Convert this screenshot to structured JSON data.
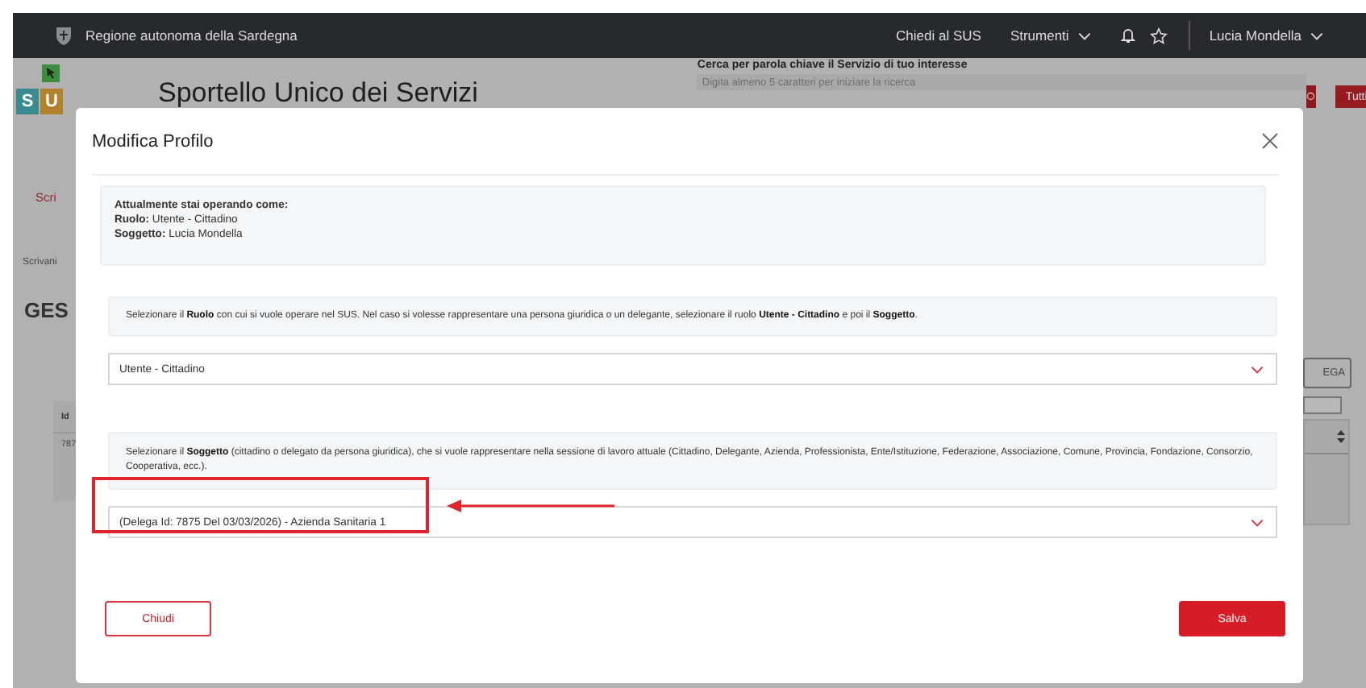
{
  "top_bar": {
    "region": "Regione autonoma della Sardegna",
    "links": [
      {
        "label": "Chiedi al SUS",
        "dropdown": false
      },
      {
        "label": "Strumenti",
        "dropdown": true
      }
    ],
    "user": "Lucia Mondella"
  },
  "header": {
    "logo_letters": [
      "S",
      "U"
    ],
    "title": "Sportello Unico dei Servizi",
    "search": {
      "label": "Cerca per parola chiave il Servizio di tuo interesse",
      "placeholder": "Digita almeno 5 caratteri per iniziare la ricerca"
    },
    "filter_button": "Tutti"
  },
  "background_left": {
    "link": "Scri",
    "breadcrumb": "Scrivani",
    "heading": "GES",
    "table": {
      "column_1": "Id",
      "cell": "787"
    }
  },
  "background_right": {
    "button": "EGA"
  },
  "dialog": {
    "title": "Modifica Profilo",
    "current": {
      "heading": "Attualmente stai operando come:",
      "lines": [
        "**Ruolo:** Utente - Cittadino",
        "**Soggetto:** Lucia Mondella"
      ]
    },
    "sections": [
      {
        "hint": "Selezionare il **Ruolo** con cui si vuole operare nel SUS. Nel caso si volesse rappresentare una persona giuridica o un delegante, selezionare il ruolo **Utente - Cittadino** e poi il **Soggetto**.",
        "value": "Utente - Cittadino",
        "highlighted": false
      },
      {
        "hint": "Selezionare il **Soggetto** (cittadino o delegato da persona giuridica), che si vuole rappresentare nella sessione di lavoro attuale (Cittadino, Delegante, Azienda, Professionista, Ente/Istituzione, Federazione, Associazione, Comune, Provincia, Fondazione, Consorzio, Cooperativa, ecc.).",
        "value": "(Delega Id: 7875 Del 03/03/2026) - Azienda Sanitaria 1",
        "highlighted": true
      }
    ],
    "buttons": [
      {
        "label": "Chiudi",
        "kind": "secondary"
      },
      {
        "label": "Salva",
        "kind": "primary"
      }
    ]
  }
}
